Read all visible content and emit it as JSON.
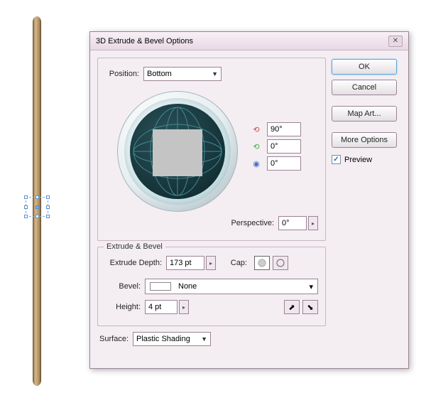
{
  "dialog": {
    "title": "3D Extrude & Bevel Options",
    "position_label": "Position:",
    "position_value": "Bottom",
    "angles": {
      "x": "90°",
      "y": "0°",
      "z": "0°"
    },
    "perspective_label": "Perspective:",
    "perspective_value": "0°",
    "extrude": {
      "legend": "Extrude & Bevel",
      "depth_label": "Extrude Depth:",
      "depth_value": "173 pt",
      "cap_label": "Cap:",
      "bevel_label": "Bevel:",
      "bevel_value": "None",
      "height_label": "Height:",
      "height_value": "4 pt"
    },
    "surface_label": "Surface:",
    "surface_value": "Plastic Shading"
  },
  "buttons": {
    "ok": "OK",
    "cancel": "Cancel",
    "map_art": "Map Art...",
    "more_options": "More Options",
    "preview": "Preview"
  }
}
